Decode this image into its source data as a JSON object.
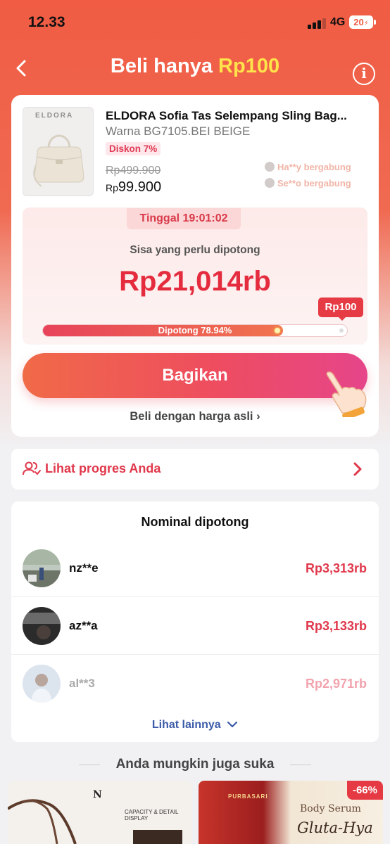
{
  "status_bar": {
    "time": "12.33",
    "network": "4G",
    "battery": "20"
  },
  "header": {
    "title_prefix": "Beli hanya ",
    "title_price": "Rp100"
  },
  "product": {
    "brand_logo": "ELDORA",
    "name": "ELDORA Sofia Tas Selempang Sling Bag...",
    "variant": "Warna BG7105.BEI BEIGE",
    "discount": "Diskon 7%",
    "original_price": "Rp499.900",
    "sale_currency": "Rp",
    "sale_amount": "99.900",
    "joined": [
      "Ha**y bergabung",
      "Se**o bergabung"
    ]
  },
  "progress": {
    "timer": "Tinggal 19:01:02",
    "remain_label": "Sisa yang perlu dipotong",
    "remain_amount": "Rp21,014rb",
    "target_badge": "Rp100",
    "cut_label": "Dipotong 78.94%",
    "cut_fraction": 0.7894,
    "share_button": "Bagikan",
    "buy_original": "Beli dengan harga asli",
    "buy_original_chevron": "›"
  },
  "progress_link": {
    "label": "Lihat progres Anda"
  },
  "contributors": {
    "title": "Nominal dipotong",
    "rows": [
      {
        "name": "nz**e",
        "amount": "Rp3,313rb"
      },
      {
        "name": "az**a",
        "amount": "Rp3,133rb"
      },
      {
        "name": "al**3",
        "amount": "Rp2,971rb"
      }
    ],
    "see_more": "Lihat lainnya"
  },
  "recommendations": {
    "title": "Anda mungkin juga suka",
    "card1": {
      "logo": "N",
      "caption": "CAPACITY & DETAIL DISPLAY"
    },
    "card2": {
      "discount": "-66%",
      "brand": "PURBASARI",
      "subtitle": "Body Serum",
      "name": "Gluta-Hya"
    }
  },
  "colors": {
    "accent": "#e0384b",
    "header_bg": "#f05c44",
    "price_highlight": "#ffe34a",
    "link": "#3b5ba8"
  }
}
